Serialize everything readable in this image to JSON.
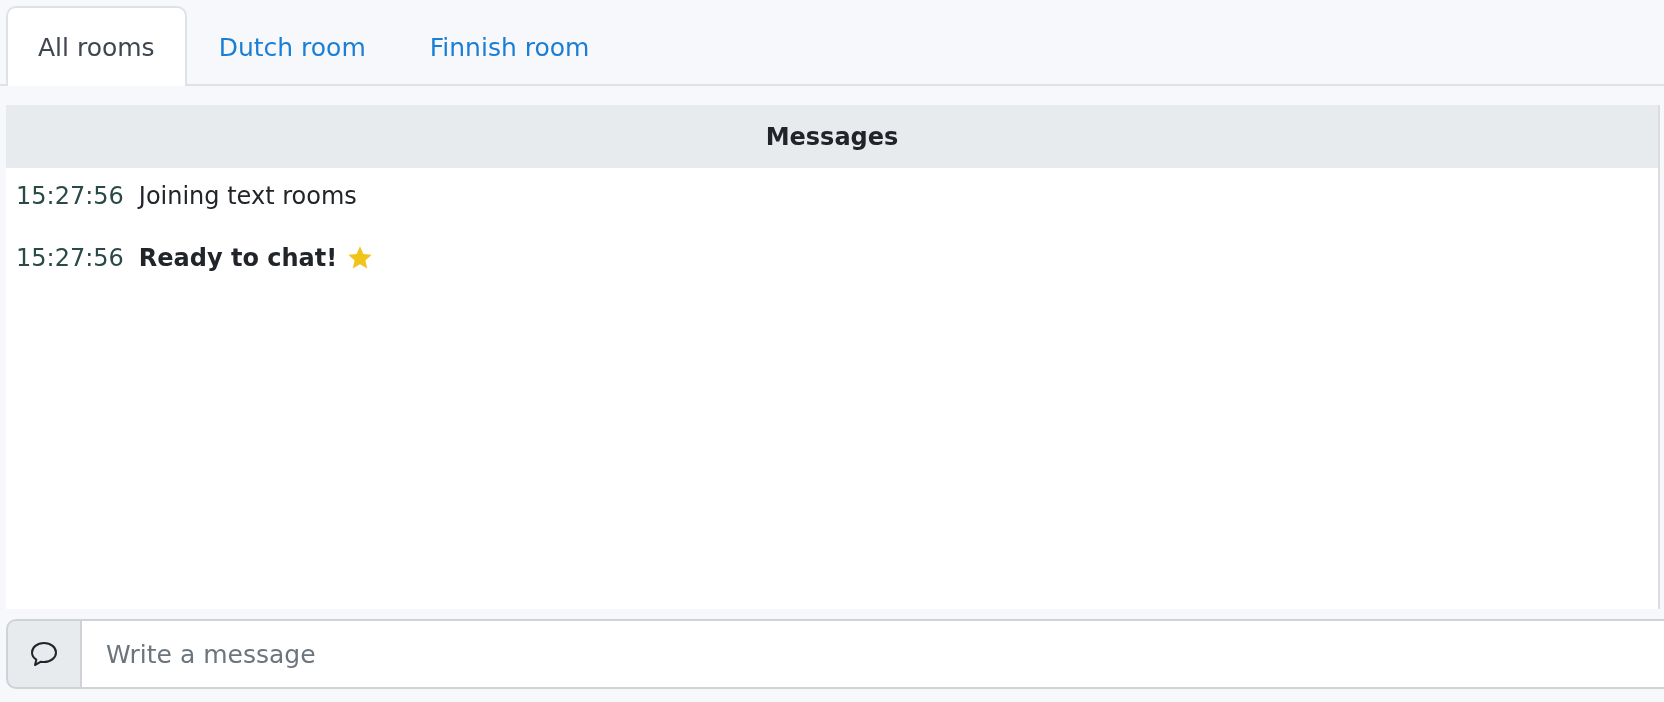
{
  "tabs": [
    {
      "label": "All rooms",
      "selected": true
    },
    {
      "label": "Dutch room",
      "selected": false
    },
    {
      "label": "Finnish room",
      "selected": false
    }
  ],
  "messages_panel": {
    "title": "Messages",
    "messages": [
      {
        "time": "15:27:56",
        "text": "Joining text rooms",
        "kind": "plain"
      },
      {
        "time": "15:27:56",
        "text": "Ready to chat!",
        "kind": "highlight"
      }
    ]
  },
  "composer": {
    "placeholder": "Write a message"
  }
}
